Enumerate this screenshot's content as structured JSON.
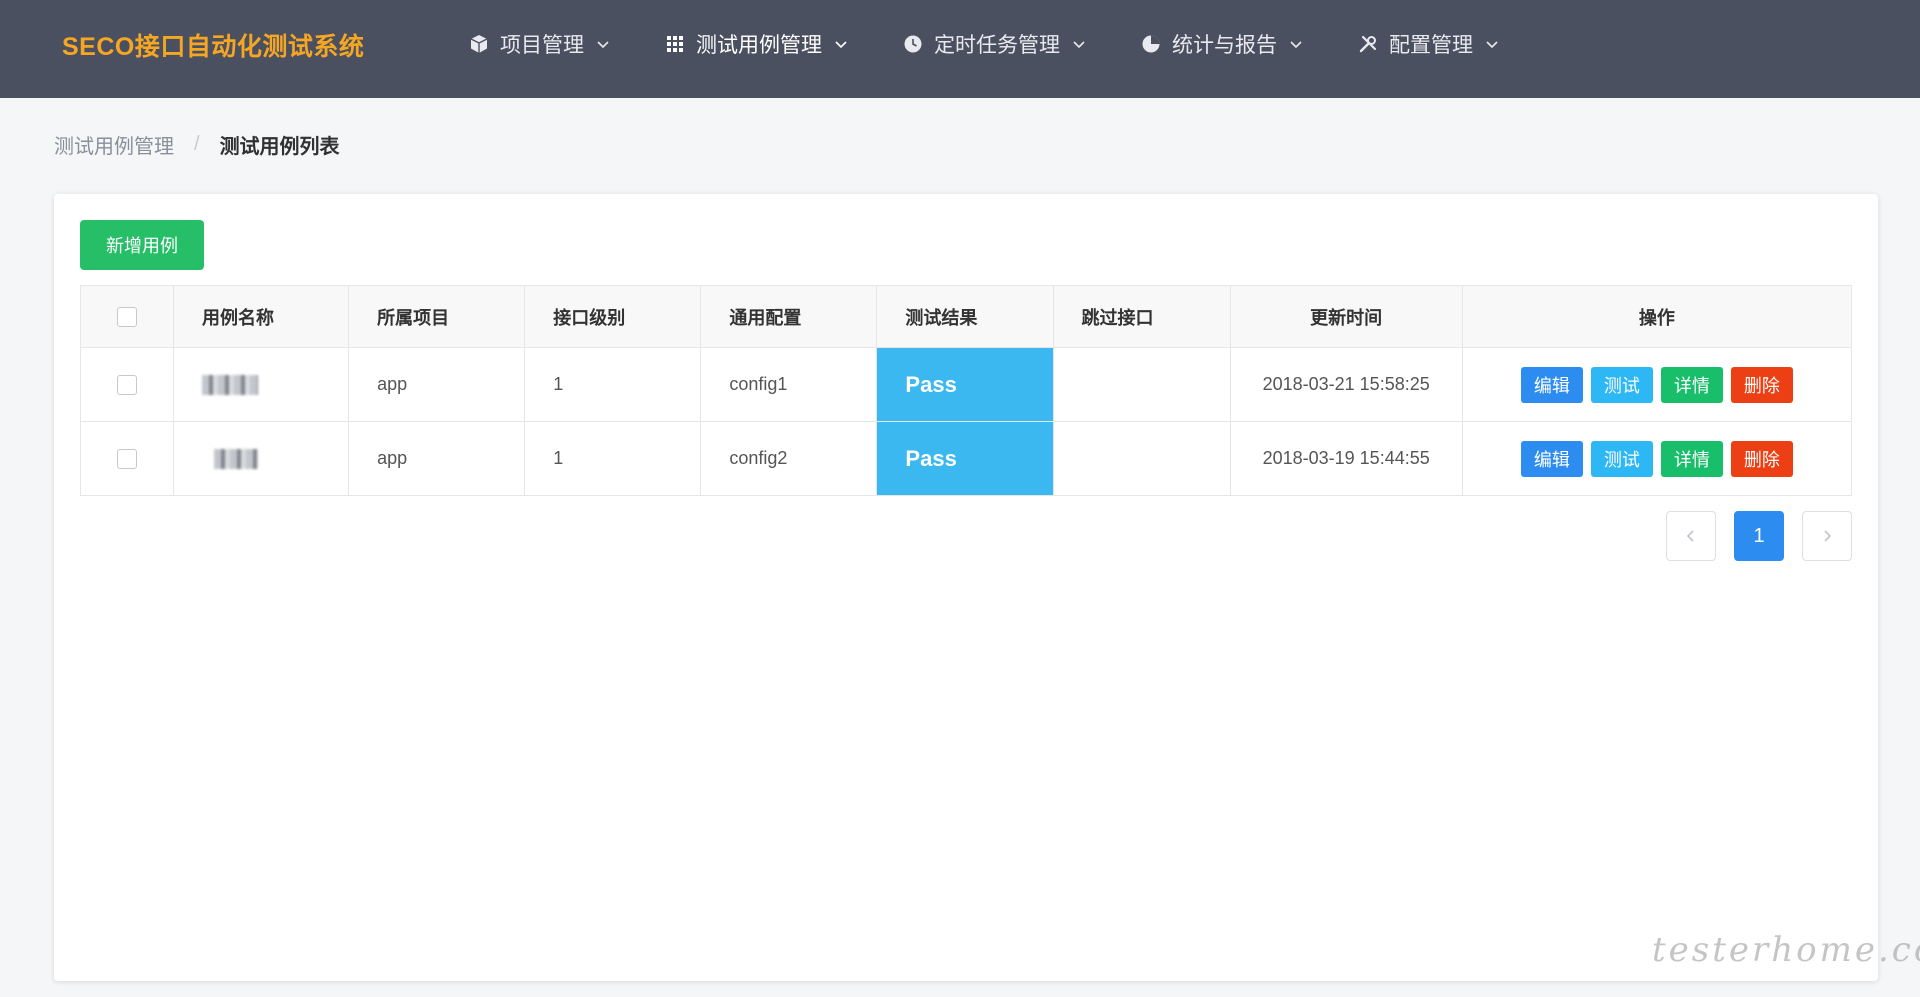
{
  "app": {
    "title": "SECO接口自动化测试系统",
    "accent_color": "#f5a623",
    "nav_bg_color": "#4b5060"
  },
  "nav": {
    "items": [
      {
        "label": "项目管理",
        "icon": "cube-icon"
      },
      {
        "label": "测试用例管理",
        "icon": "grid-icon",
        "active": true
      },
      {
        "label": "定时任务管理",
        "icon": "clock-icon"
      },
      {
        "label": "统计与报告",
        "icon": "pie-chart-icon"
      },
      {
        "label": "配置管理",
        "icon": "tools-icon"
      }
    ]
  },
  "breadcrumb": {
    "parent": "测试用例管理",
    "separator": "/",
    "current": "测试用例列表"
  },
  "toolbar": {
    "add_label": "新增用例",
    "add_color": "#27be68"
  },
  "table": {
    "columns": [
      "用例名称",
      "所属项目",
      "接口级别",
      "通用配置",
      "测试结果",
      "跳过接口",
      "更新时间",
      "操作"
    ],
    "rows": [
      {
        "name": "",
        "project": "app",
        "level": "1",
        "config": "config1",
        "result": "Pass",
        "skip": "",
        "updated": "2018-03-21 15:58:25"
      },
      {
        "name": "",
        "project": "app",
        "level": "1",
        "config": "config2",
        "result": "Pass",
        "skip": "",
        "updated": "2018-03-19 15:44:55"
      }
    ],
    "result_color": "#3bb8ef",
    "actions": [
      {
        "label": "编辑",
        "color": "#2d8cf0"
      },
      {
        "label": "测试",
        "color": "#2db7f5"
      },
      {
        "label": "详情",
        "color": "#19be6b"
      },
      {
        "label": "删除",
        "color": "#ed3f14"
      }
    ]
  },
  "pagination": {
    "current_page": "1"
  },
  "watermark": "testerhome.com"
}
